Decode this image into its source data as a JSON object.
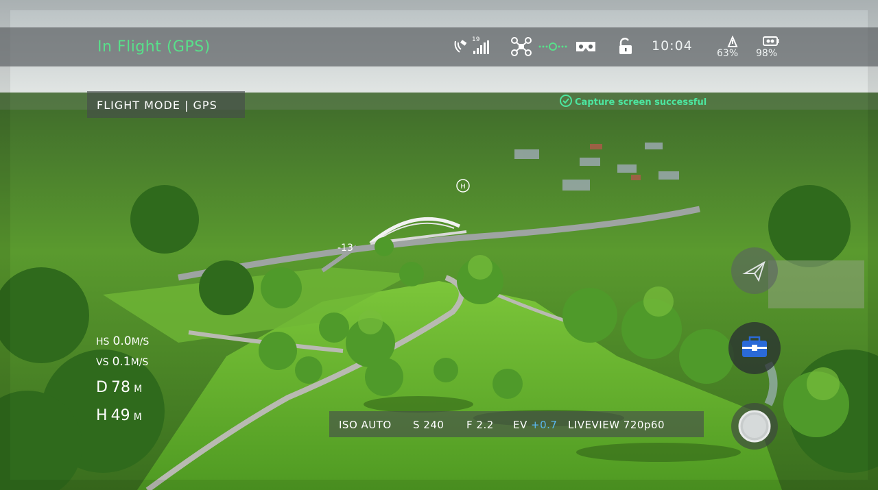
{
  "status_bar": {
    "flight_status": "In Flight (GPS)",
    "satellite_count": "19",
    "clock": "10:04",
    "rc_battery": "63%",
    "aircraft_battery": "98%"
  },
  "flight_mode": {
    "label": "FLIGHT MODE | GPS"
  },
  "notification": {
    "text": "Capture screen successful"
  },
  "heading": {
    "value": "-13"
  },
  "telemetry": {
    "hs_label": "HS",
    "hs_value": "0.0",
    "hs_unit": "M/S",
    "vs_label": "VS",
    "vs_value": "0.1",
    "vs_unit": "M/S",
    "d_label": "D",
    "d_value": "78",
    "d_unit": "M",
    "h_label": "H",
    "h_value": "49",
    "h_unit": "M"
  },
  "camera_settings": {
    "iso": "ISO AUTO",
    "shutter": "S 240",
    "aperture": "F 2.2",
    "ev_label": "EV",
    "ev_value": "+0.7",
    "liveview": "LIVEVIEW 720p60"
  },
  "icons": {
    "gps_satellite": "satellite-signal-icon",
    "aircraft": "drone-icon",
    "link": "link-signal-icon",
    "vr": "vr-goggles-icon",
    "lock": "unlock-icon",
    "rc_battery": "rc-battery-icon",
    "aircraft_battery": "aircraft-battery-icon",
    "intelligent_flight": "paper-plane-icon",
    "toolbox": "toolbox-icon",
    "shutter": "shutter-button-icon",
    "capture_check": "check-circle-icon"
  },
  "colors": {
    "status_green": "#58e08a",
    "notification_green": "#4ce6a0",
    "ev_blue": "#5ab8f0",
    "toolbox_blue": "#2a6ad8"
  }
}
